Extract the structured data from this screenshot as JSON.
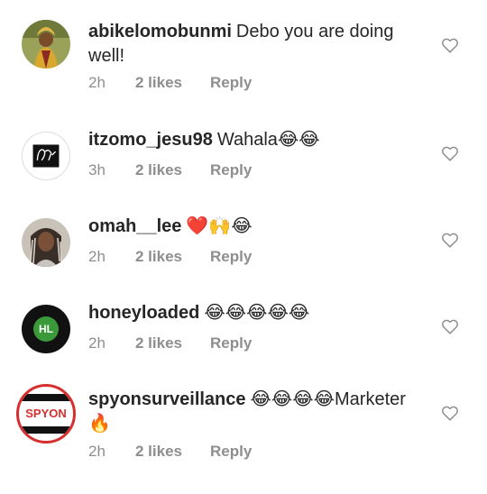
{
  "comments": [
    {
      "username": "abikelomobunmi",
      "text": "Debo you are doing well!",
      "time": "2h",
      "likes": "2 likes",
      "reply": "Reply"
    },
    {
      "username": "itzomo_jesu98",
      "text": "Wahala😂😂",
      "time": "3h",
      "likes": "2 likes",
      "reply": "Reply"
    },
    {
      "username": "omah__lee",
      "text": "❤️🙌😂",
      "time": "2h",
      "likes": "2 likes",
      "reply": "Reply"
    },
    {
      "username": "honeyloaded",
      "text": "😂😂😂😂😂",
      "time": "2h",
      "likes": "2 likes",
      "reply": "Reply"
    },
    {
      "username": "spyonsurveillance",
      "text": "😂😂😂😂Marketer 🔥",
      "time": "2h",
      "likes": "2 likes",
      "reply": "Reply"
    }
  ],
  "avatars": {
    "honeyloaded_initials": "HL",
    "spyon_logo": "SPYON"
  },
  "icons": {
    "like": "heart-outline-icon"
  },
  "colors": {
    "text": "#262626",
    "secondary": "#8e8e8e",
    "honeyloaded_green": "#3a9a3a",
    "spyon_red": "#d62f2f"
  }
}
